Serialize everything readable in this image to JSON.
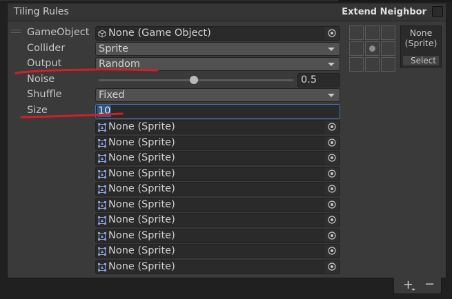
{
  "header": {
    "title": "Tiling Rules",
    "extend_neighbor_label": "Extend Neighbor"
  },
  "rule": {
    "gameobject": {
      "label": "GameObject",
      "value": "None (Game Object)"
    },
    "collider": {
      "label": "Collider",
      "value": "Sprite"
    },
    "output": {
      "label": "Output",
      "value": "Random"
    },
    "noise": {
      "label": "Noise",
      "value": "0.5",
      "slider_fraction": 0.5
    },
    "shuffle": {
      "label": "Shuffle",
      "value": "Fixed"
    },
    "size": {
      "label": "Size",
      "value": "10"
    },
    "sprites": [
      "None (Sprite)",
      "None (Sprite)",
      "None (Sprite)",
      "None (Sprite)",
      "None (Sprite)",
      "None (Sprite)",
      "None (Sprite)",
      "None (Sprite)",
      "None (Sprite)",
      "None (Sprite)"
    ]
  },
  "preview": {
    "line1": "None",
    "line2": "(Sprite)",
    "select_label": "Select"
  },
  "footer": {
    "add_label": "+",
    "remove_label": "−"
  },
  "colors": {
    "annotation": "#d41f2a",
    "focus": "#3a79bb"
  }
}
